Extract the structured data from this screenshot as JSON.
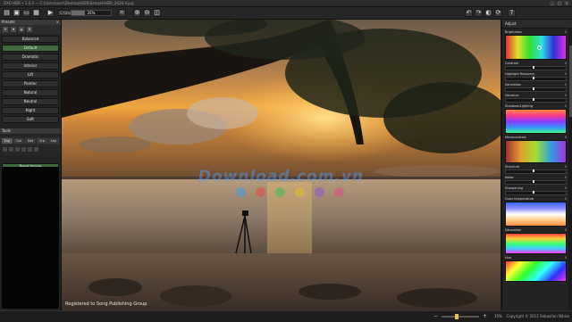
{
  "window": {
    "title": "DXO HDR • 1.0.4 — C:\\Users\\user\\Desktop\\HDR\\Sample\\HDR_2020-4.jpg",
    "min": "_",
    "max": "□",
    "close": "✕"
  },
  "toolbar": {
    "path_text": "C:\\Users\\user\\Desktop\\HDR\\Sample\\HDR_2020-4.jpg",
    "zoom_value": 0.35,
    "zoom_label": "35%"
  },
  "presets": {
    "header": "Presets",
    "items": [
      "Balanced",
      "Default",
      "Dramatic",
      "Interior",
      "Lift",
      "Painter",
      "Natural",
      "Neutral",
      "Night",
      "Soft"
    ],
    "selected_index": 1
  },
  "tools_panel": {
    "header": "Tools",
    "tabs": [
      "Exp",
      "Col",
      "Det",
      "Crp",
      "Lay"
    ],
    "reset_label": "Reset Image"
  },
  "photo": {
    "watermark": "Download.com.vn",
    "credit": "Registered to Song Publishing Group"
  },
  "adjustments": {
    "header": "Adjust",
    "sections": [
      {
        "label": "Brightness",
        "value": "0"
      },
      {
        "label": "Contrast",
        "value": "0"
      },
      {
        "label": "Highlight Recovery",
        "value": "0"
      },
      {
        "label": "Saturation",
        "value": "0"
      },
      {
        "label": "Vibrance",
        "value": "0"
      },
      {
        "label": "Shadows/Lighting",
        "value": "0"
      },
      {
        "label": "Microcontrast",
        "value": "0"
      },
      {
        "label": "Structure",
        "value": "0"
      },
      {
        "label": "Noise",
        "value": "0"
      },
      {
        "label": "Sharpening",
        "value": "0"
      },
      {
        "label": "Color temperature",
        "value": "0"
      },
      {
        "label": "Saturation",
        "value": "0"
      },
      {
        "label": "Hue",
        "value": "0"
      }
    ]
  },
  "status": {
    "zoom_pct": "35%",
    "copyright": "Copyright © 2012 Sebastian Nibisz"
  },
  "colors": {
    "accent_green": "#3e6a3e",
    "panel_bg": "#232323"
  }
}
